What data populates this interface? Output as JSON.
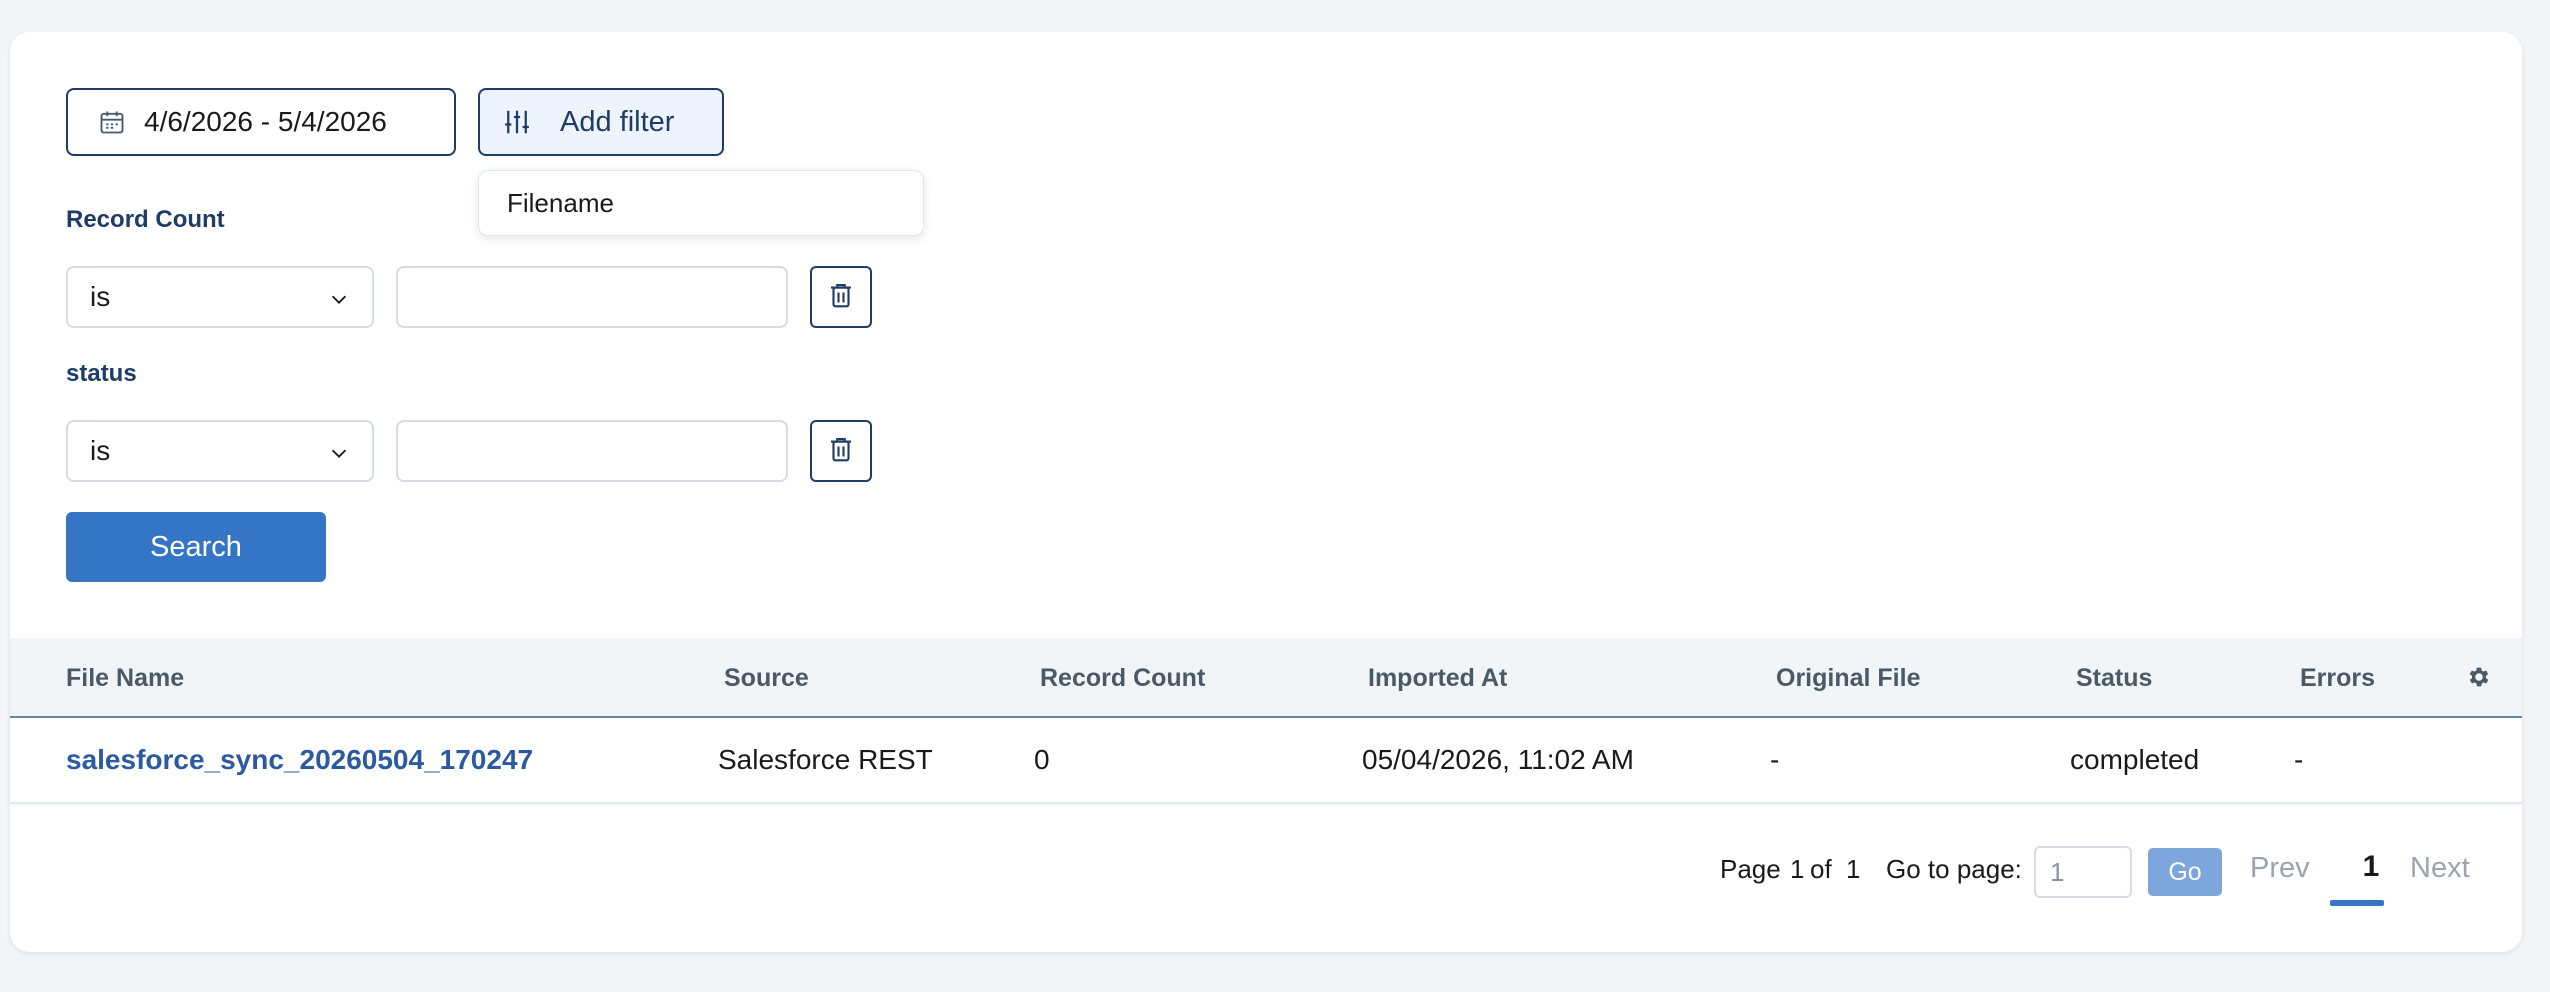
{
  "filters": {
    "date_range": "4/6/2026 - 5/4/2026",
    "add_filter_label": "Add filter",
    "dropdown_option": "Filename",
    "rows": [
      {
        "label": "Record Count",
        "operator": "is",
        "value": ""
      },
      {
        "label": "status",
        "operator": "is",
        "value": ""
      }
    ],
    "search_label": "Search"
  },
  "table": {
    "columns": [
      "File Name",
      "Source",
      "Record Count",
      "Imported At",
      "Original File",
      "Status",
      "Errors"
    ],
    "rows": [
      {
        "file_name": "salesforce_sync_20260504_170247",
        "source": "Salesforce REST",
        "record_count": "0",
        "imported_at": "05/04/2026, 11:02 AM",
        "original_file": "-",
        "status": "completed",
        "errors": "-"
      }
    ]
  },
  "pagination": {
    "page_label": "Page",
    "current": "1",
    "of_label": "of",
    "total": "1",
    "go_to_label": "Go to page:",
    "input_value": "1",
    "go_label": "Go",
    "prev_label": "Prev",
    "next_label": "Next",
    "active_page": "1"
  },
  "colors": {
    "primary": "#3575c6",
    "navy": "#1f3c66",
    "link": "#2c5aa0"
  },
  "icons": [
    "calendar-icon",
    "sliders-icon",
    "chevron-down-icon",
    "trash-icon",
    "gear-icon"
  ]
}
